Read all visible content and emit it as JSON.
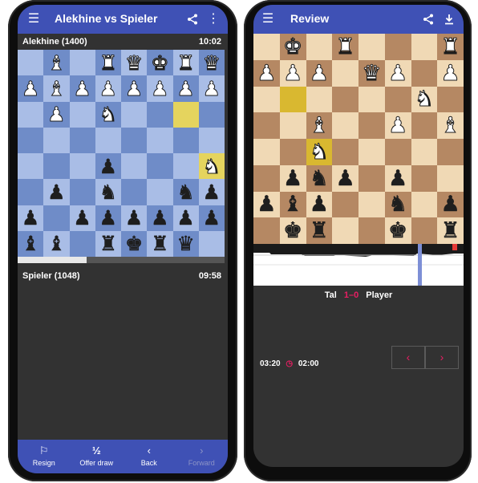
{
  "left": {
    "title": "Alekhine vs Spieler",
    "opponent": {
      "name": "Alekhine (1400)",
      "time": "10:02"
    },
    "player": {
      "name": "Spieler (1048)",
      "time": "09:58"
    },
    "board": [
      [
        "",
        "wB",
        "",
        "wR",
        "wQ",
        "wK",
        "wR",
        "wQ"
      ],
      [
        "wP",
        "wB",
        "wP",
        "wP",
        "wP",
        "wP",
        "wP",
        "wP"
      ],
      [
        "",
        "wP",
        "",
        "wN",
        "",
        "",
        "hl",
        ""
      ],
      [
        "",
        "",
        "",
        "",
        "",
        "",
        "",
        ""
      ],
      [
        "",
        "",
        "",
        "bP",
        "",
        "",
        "",
        "hl:wN"
      ],
      [
        "",
        "bP",
        "",
        "bN",
        "",
        "",
        "bN",
        "bP"
      ],
      [
        "bP",
        "",
        "bP",
        "bP",
        "bP",
        "bP",
        "bP",
        "bP"
      ],
      [
        "bB",
        "bB",
        "",
        "bR",
        "bK",
        "bR",
        "bQ",
        ""
      ]
    ],
    "colors": {
      "light": "#a9bde6",
      "dark": "#6f8cc8",
      "highlight": "#e5d45e"
    },
    "nav": [
      {
        "icon": "flag-icon",
        "glyph": "⚐",
        "label": "Resign"
      },
      {
        "icon": "half-icon",
        "glyph": "½",
        "label": "Offer draw"
      },
      {
        "icon": "chevron-left-icon",
        "glyph": "‹",
        "label": "Back"
      },
      {
        "icon": "chevron-right-icon",
        "glyph": "›",
        "label": "Forward"
      }
    ]
  },
  "right": {
    "title": "Review",
    "board": [
      [
        "",
        "wK",
        "",
        "wR",
        "",
        "",
        "",
        "wR"
      ],
      [
        "wP",
        "wP",
        "wP",
        "",
        "wQ",
        "wP",
        "",
        "wP"
      ],
      [
        "",
        "hl",
        "",
        "",
        "",
        "",
        "wN",
        ""
      ],
      [
        "",
        "",
        "wB",
        "",
        "",
        "wP",
        "",
        "wB"
      ],
      [
        "",
        "",
        "hl:wN",
        "",
        "",
        "",
        "",
        ""
      ],
      [
        "",
        "bP",
        "bN",
        "bP",
        "",
        "bP",
        "",
        ""
      ],
      [
        "bP",
        "bB",
        "bP",
        "",
        "",
        "bN",
        "",
        "bP"
      ],
      [
        "",
        "bK",
        "bR",
        "",
        "",
        "bK",
        "",
        "bR"
      ]
    ],
    "colors": {
      "light": "#f0d9b5",
      "dark": "#b58863",
      "highlight": "#d9b830"
    },
    "players": {
      "white": "Tal",
      "result": "1–0",
      "black": "Player"
    },
    "clocks": {
      "white": "03:20",
      "black": "02:00"
    },
    "icons": [
      "menu-icon",
      "share-icon",
      "download-icon",
      "clock-icon"
    ]
  }
}
